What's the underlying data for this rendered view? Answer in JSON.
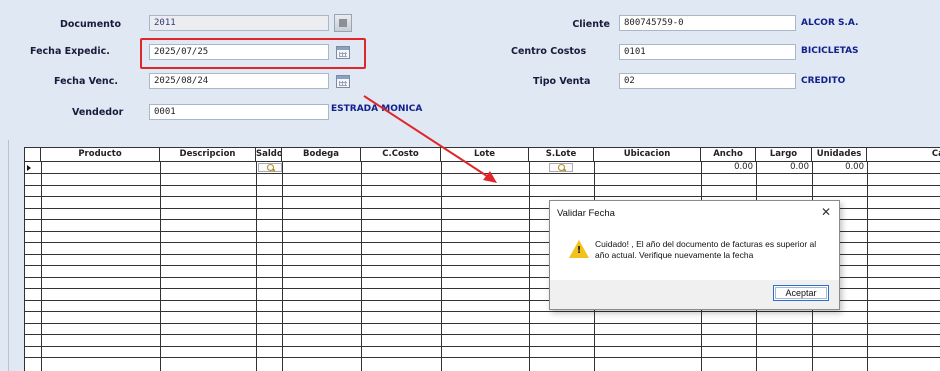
{
  "form": {
    "documento": {
      "label": "Documento",
      "value": "2011"
    },
    "fecha_expedic": {
      "label": "Fecha Expedic.",
      "value": "2025/07/25"
    },
    "fecha_venc": {
      "label": "Fecha Venc.",
      "value": "2025/08/24"
    },
    "vendedor": {
      "label": "Vendedor",
      "value": "0001",
      "name": "ESTRADA MONICA"
    },
    "cliente": {
      "label": "Cliente",
      "value": "800745759-0",
      "name": "ALCOR S.A."
    },
    "centro_costos": {
      "label": "Centro Costos",
      "value": "0101",
      "name": "BICICLETAS"
    },
    "tipo_venta": {
      "label": "Tipo Venta",
      "value": "02",
      "name": "CREDITO"
    }
  },
  "grid": {
    "columns": [
      "Producto",
      "Descripcion",
      "Saldo",
      "Bodega",
      "C.Costo",
      "Lote",
      "S.Lote",
      "Ubicacion",
      "Ancho",
      "Largo",
      "Unidades",
      "Cant"
    ],
    "first_row": {
      "ancho": "0.00",
      "largo": "0.00",
      "unidades": "0.00"
    }
  },
  "dialog": {
    "title": "Validar Fecha",
    "message": "Cuidado! , El año del documento de facturas es superior al año actual. Verifique nuevamente la fecha",
    "ok_label": "Aceptar",
    "close_symbol": "✕",
    "icon": "warning-icon"
  },
  "colors": {
    "background": "#dfe8f3",
    "label_value_blue": "#12218c",
    "highlight_red": "#e0262a",
    "warning_yellow": "#f1c21b"
  }
}
